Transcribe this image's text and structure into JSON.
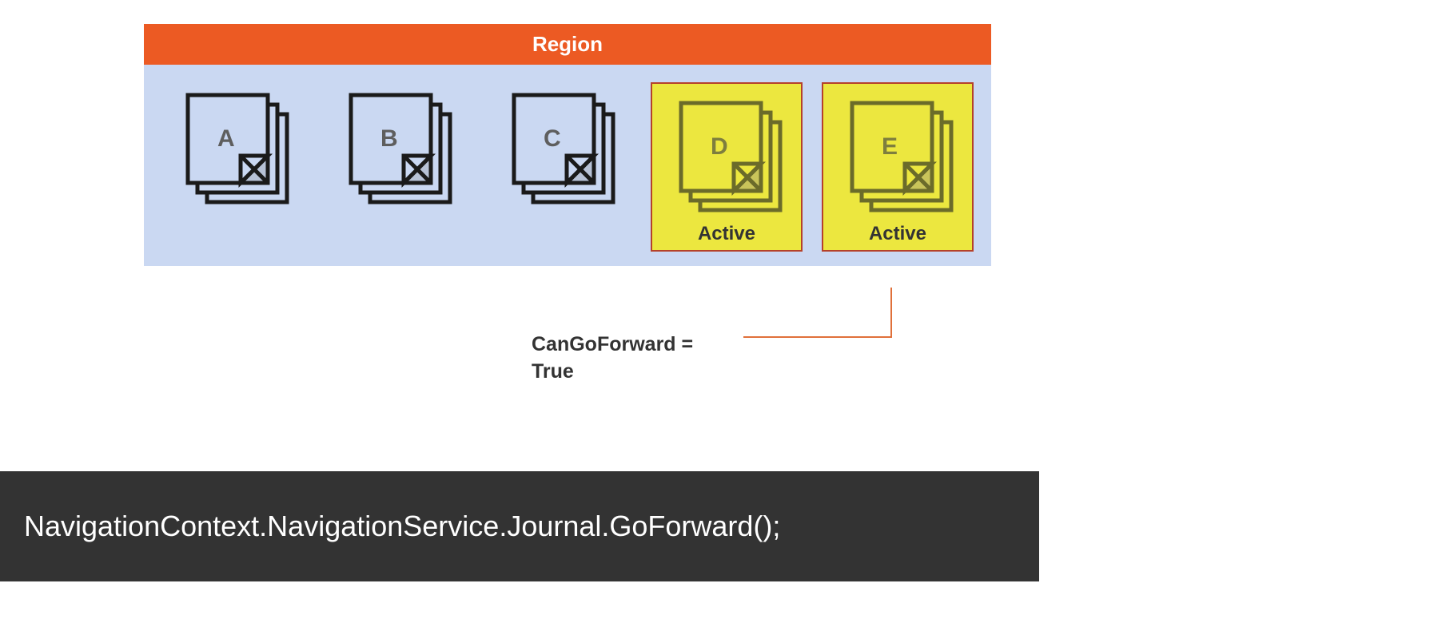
{
  "region": {
    "title": "Region",
    "items": [
      {
        "label": "A",
        "active": false
      },
      {
        "label": "B",
        "active": false
      },
      {
        "label": "C",
        "active": false
      },
      {
        "label": "D",
        "active": true,
        "activeLabel": "Active"
      },
      {
        "label": "E",
        "active": true,
        "activeLabel": "Active"
      }
    ]
  },
  "annotation": {
    "line1": "CanGoForward =",
    "line2": "True"
  },
  "code": "NavigationContext.NavigationService.Journal.GoForward();"
}
